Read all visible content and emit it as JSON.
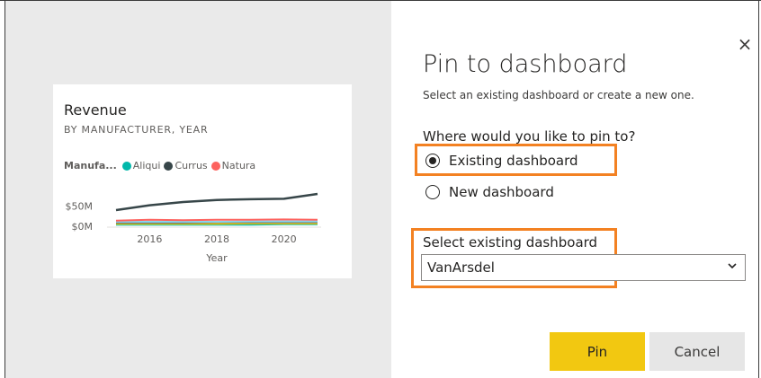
{
  "card": {
    "title": "Revenue",
    "subtitle": "BY MANUFACTURER, YEAR",
    "legend_title": "Manufa...",
    "legend": [
      {
        "name": "Aliqui",
        "color": "#01b8aa"
      },
      {
        "name": "Currus",
        "color": "#374649"
      },
      {
        "name": "Natura",
        "color": "#fd625e"
      }
    ]
  },
  "chart_data": {
    "type": "line",
    "title": "Revenue",
    "subtitle": "BY MANUFACTURER, YEAR",
    "xlabel": "Year",
    "ylabel": "",
    "x": [
      2015,
      2016,
      2017,
      2018,
      2019,
      2020,
      2021
    ],
    "xticks": [
      2016,
      2018,
      2020
    ],
    "yticks": [
      {
        "value": 0,
        "label": "$0M"
      },
      {
        "value": 50,
        "label": "$50M"
      }
    ],
    "xlim": [
      2015,
      2021
    ],
    "ylim": [
      0,
      80
    ],
    "legend_position": "top-left",
    "series": [
      {
        "name": "Currus",
        "color": "#374649",
        "values": [
          40,
          52,
          60,
          65,
          67,
          68,
          80
        ]
      },
      {
        "name": "Natura",
        "color": "#fd625e",
        "values": [
          14,
          16,
          15,
          16,
          16,
          17,
          16
        ]
      },
      {
        "color": "#8ad4eb",
        "values": [
          11,
          11,
          11,
          11,
          12,
          12,
          12
        ]
      },
      {
        "color": "#5f6b6d",
        "values": [
          9,
          9,
          9,
          10,
          10,
          10,
          10
        ]
      },
      {
        "color": "#f2c80f",
        "values": [
          6,
          6,
          6,
          6,
          7,
          7,
          7
        ]
      },
      {
        "name": "Aliqui",
        "color": "#01b8aa",
        "values": [
          4,
          4,
          4,
          4,
          4,
          5,
          5
        ]
      }
    ]
  },
  "dialog": {
    "title": "Pin to dashboard",
    "subtitle": "Select an existing dashboard or create a new one.",
    "question": "Where would you like to pin to?",
    "options": [
      {
        "label": "Existing dashboard",
        "checked": true
      },
      {
        "label": "New dashboard",
        "checked": false
      }
    ],
    "select_label": "Select existing dashboard",
    "select_value": "VanArsdel",
    "pin_label": "Pin",
    "cancel_label": "Cancel",
    "close_symbol": "×",
    "highlight_color": "#f38122",
    "accent_color": "#f2c811"
  }
}
